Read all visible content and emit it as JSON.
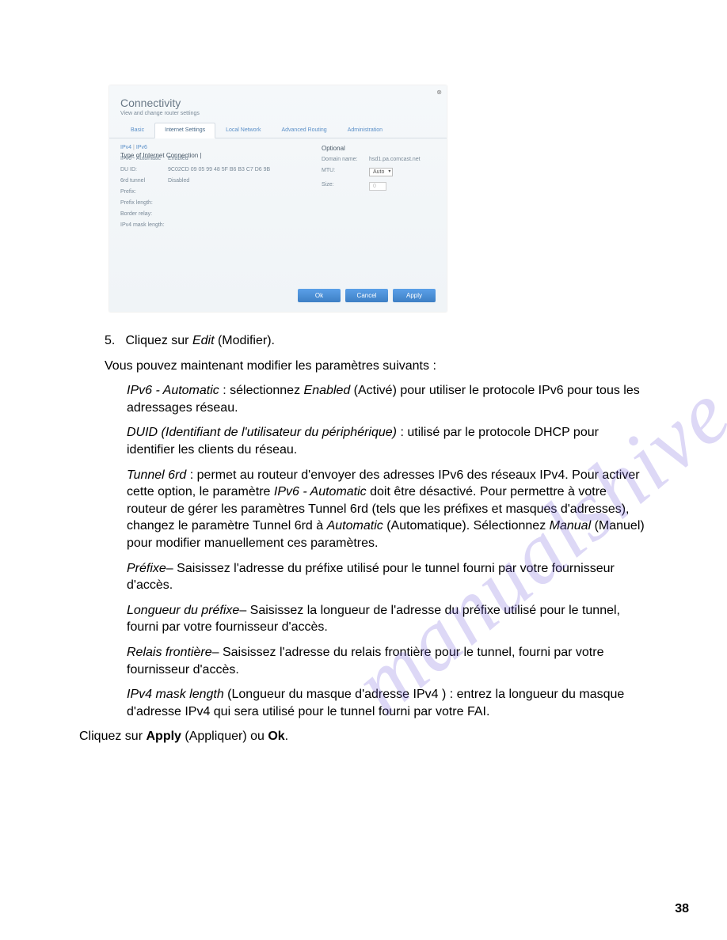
{
  "watermark": "manualshive.com",
  "panel": {
    "title": "Connectivity",
    "subtitle": "View and change router settings",
    "tabs": [
      "Basic",
      "Internet Settings",
      "Local Network",
      "Advanced Routing",
      "Administration"
    ],
    "subtab_ipv4": "IPv4",
    "subtab_ipv6": "IPv6",
    "left_title": "Type of Internet Connection  |",
    "fields_left": {
      "ipv6auto_lbl": "IPv6 - Automatic",
      "ipv6auto_val": "Enabled",
      "duid_lbl": "DU ID:",
      "duid_val": "9C02CD 09 05 99 48 5F B6 B3 C7 D6 9B",
      "6rd_lbl": "6rd tunnel",
      "6rd_val": "Disabled",
      "prefix_lbl": "Prefix:",
      "prefixlen_lbl": "Prefix length:",
      "border_lbl": "Border relay:",
      "ipv4mask_lbl": "IPv4 mask length:"
    },
    "right_title": "Optional",
    "fields_right": {
      "domain_lbl": "Domain name:",
      "domain_val": "hsd1.pa.comcast.net",
      "mtu_lbl": "MTU:",
      "mtu_val": "Auto",
      "size_lbl": "Size:",
      "size_val": "0"
    },
    "buttons": {
      "ok": "Ok",
      "cancel": "Cancel",
      "apply": "Apply"
    }
  },
  "doc": {
    "step5_num": "5.",
    "step5_pre": "Cliquez sur ",
    "step5_em": "Edit",
    "step5_post": " (Modifier).",
    "intro": "Vous pouvez maintenant modifier les paramètres suivants :",
    "p1_em": "IPv6 - Automatic",
    "p1_mid": " : sélectionnez ",
    "p1_em2": "Enabled",
    "p1_post": " (Activé) pour utiliser le protocole IPv6 pour tous les adressages réseau.",
    "p2_em": "DUID (Identifiant de l'utilisateur du périphérique)",
    "p2_post": " : utilisé par le protocole DHCP pour identifier les clients du réseau.",
    "p3_em": "Tunnel 6rd",
    "p3_a": " : permet au routeur d'envoyer des adresses IPv6 des réseaux IPv4. Pour activer cette option, le paramètre ",
    "p3_em2": "IPv6 - Automatic",
    "p3_b": " doit être désactivé. Pour permettre à votre routeur de gérer les paramètres Tunnel 6rd (tels que les préfixes et masques d'adresses), changez le paramètre Tunnel 6rd à ",
    "p3_em3": "Automatic",
    "p3_c": " (Automatique). Sélectionnez ",
    "p3_em4": "Manual",
    "p3_d": " (Manuel) pour modifier manuellement ces paramètres.",
    "p4_em": "Préfixe",
    "p4_post": "– Saisissez l'adresse du préfixe utilisé pour le tunnel fourni par votre fournisseur d'accès.",
    "p5_em": "Longueur du préfixe",
    "p5_post": "– Saisissez la longueur de l'adresse du préfixe utilisé pour le tunnel, fourni par votre fournisseur d'accès.",
    "p6_em": "Relais frontière",
    "p6_post": "– Saisissez l'adresse du relais frontière pour le tunnel, fourni par votre fournisseur d'accès.",
    "p7_em": "IPv4 mask length",
    "p7_post": " (Longueur du masque d'adresse IPv4 ) : entrez la longueur du masque d'adresse IPv4 qui sera utilisé pour le tunnel fourni par votre FAI.",
    "final_a": "Cliquez sur ",
    "final_b1": "Apply",
    "final_c": " (Appliquer) ou ",
    "final_b2": "Ok",
    "final_d": "."
  },
  "page_number": "38"
}
